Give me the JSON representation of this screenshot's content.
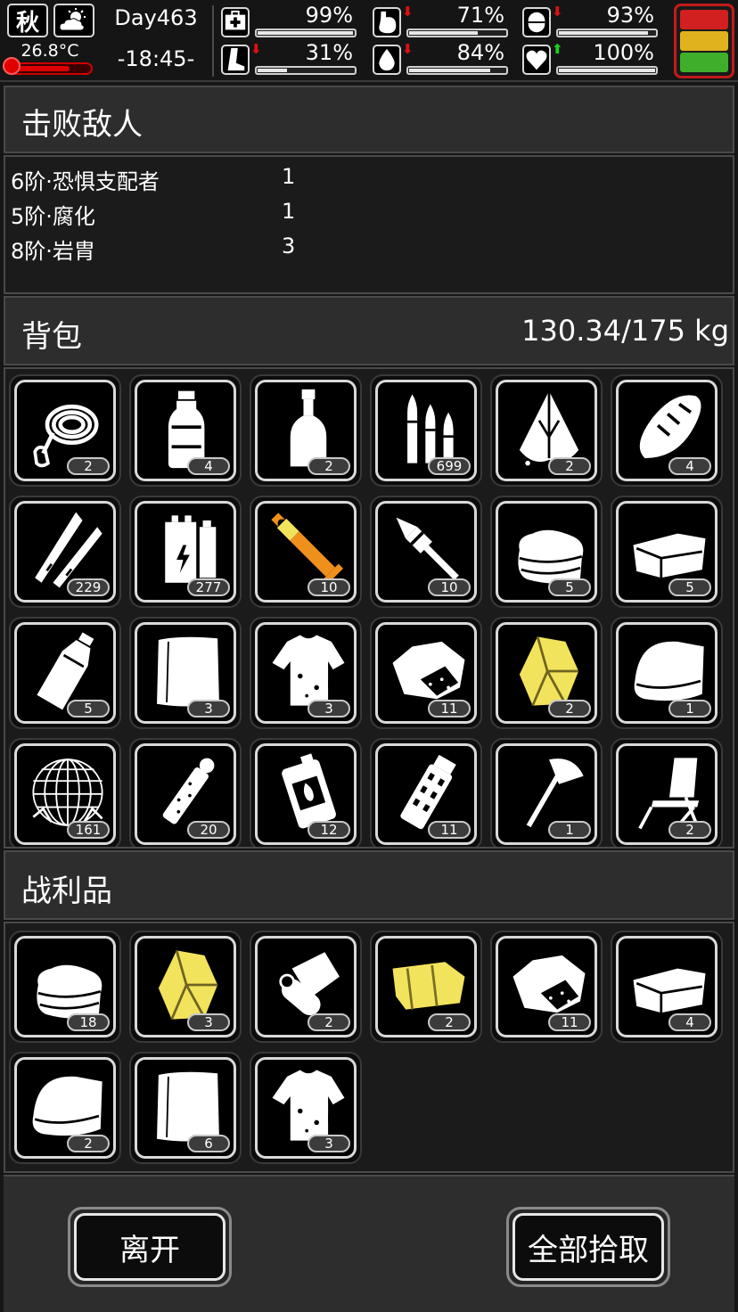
{
  "status": {
    "season": "秋",
    "weather_icon": "partly-cloudy-icon",
    "temperature": "26.8°C",
    "temperature_level": 0.75,
    "day": "Day463",
    "time": "-18:45-",
    "stats": [
      {
        "name": "health",
        "icon": "medkit-icon",
        "value": "99%",
        "level": 0.99,
        "trend": "none"
      },
      {
        "name": "hunger",
        "icon": "stomach-icon",
        "value": "71%",
        "level": 0.71,
        "trend": "down"
      },
      {
        "name": "sanity",
        "icon": "pill-icon",
        "value": "93%",
        "level": 0.93,
        "trend": "down"
      },
      {
        "name": "stamina",
        "icon": "leg-icon",
        "value": "31%",
        "level": 0.31,
        "trend": "down"
      },
      {
        "name": "thirst",
        "icon": "water-drop-icon",
        "value": "84%",
        "level": 0.84,
        "trend": "down"
      },
      {
        "name": "mood",
        "icon": "heart-icon",
        "value": "100%",
        "level": 1.0,
        "trend": "up"
      }
    ],
    "signal_colors": [
      "#d21f1f",
      "#e0b21e",
      "#3fae2a"
    ]
  },
  "defeated": {
    "title": "击败敌人",
    "enemies": [
      {
        "name": "6阶·恐惧支配者",
        "count": "1"
      },
      {
        "name": "5阶·腐化",
        "count": "1"
      },
      {
        "name": "8阶·岩胄",
        "count": "3"
      }
    ]
  },
  "backpack": {
    "title": "背包",
    "weight": "130.34/175 kg",
    "items": [
      {
        "icon": "rope-icon",
        "count": "2"
      },
      {
        "icon": "water-bottle-icon",
        "count": "4"
      },
      {
        "icon": "liquor-bottle-icon",
        "count": "2"
      },
      {
        "icon": "bullets-icon",
        "count": "699"
      },
      {
        "icon": "raw-meat-icon",
        "count": "2"
      },
      {
        "icon": "bread-icon",
        "count": "4"
      },
      {
        "icon": "rifle-rounds-icon",
        "count": "229"
      },
      {
        "icon": "battery-icon",
        "count": "277"
      },
      {
        "icon": "rocket-icon",
        "count": "10"
      },
      {
        "icon": "rpg-round-icon",
        "count": "10"
      },
      {
        "icon": "folded-cloth-icon",
        "count": "5"
      },
      {
        "icon": "fabric-icon",
        "count": "5"
      },
      {
        "icon": "plastic-bottle-icon",
        "count": "5"
      },
      {
        "icon": "paper-icon",
        "count": "3"
      },
      {
        "icon": "torn-shirt-icon",
        "count": "3"
      },
      {
        "icon": "ore-icon",
        "count": "11"
      },
      {
        "icon": "gold-crystal-icon",
        "count": "2"
      },
      {
        "icon": "towel-icon",
        "count": "1"
      },
      {
        "icon": "net-icon",
        "count": "161"
      },
      {
        "icon": "flare-icon",
        "count": "20"
      },
      {
        "icon": "fuel-canister-icon",
        "count": "12"
      },
      {
        "icon": "grenade-icon",
        "count": "11"
      },
      {
        "icon": "axe-icon",
        "count": "1"
      },
      {
        "icon": "folding-chair-icon",
        "count": "2"
      }
    ]
  },
  "loot": {
    "title": "战利品",
    "items": [
      {
        "icon": "folded-cloth-icon",
        "count": "18"
      },
      {
        "icon": "gold-crystal-icon",
        "count": "3"
      },
      {
        "icon": "fabric-roll-icon",
        "count": "2"
      },
      {
        "icon": "gold-fabric-icon",
        "count": "2"
      },
      {
        "icon": "ore-icon",
        "count": "11"
      },
      {
        "icon": "fabric-icon",
        "count": "4"
      },
      {
        "icon": "towel-icon",
        "count": "2"
      },
      {
        "icon": "paper-icon",
        "count": "6"
      },
      {
        "icon": "torn-shirt-icon",
        "count": "3"
      }
    ]
  },
  "buttons": {
    "leave": "离开",
    "take_all": "全部拾取"
  }
}
